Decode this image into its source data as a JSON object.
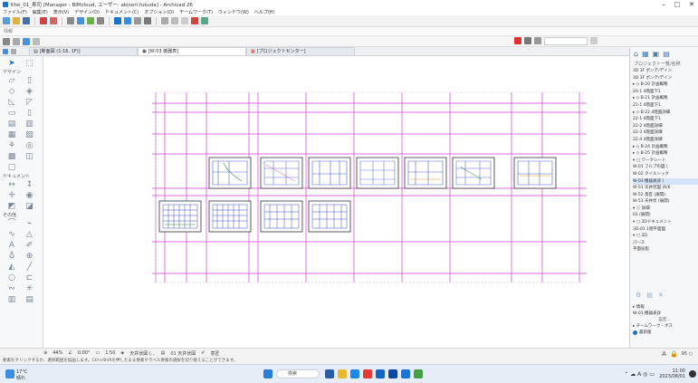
{
  "window": {
    "title": "Kho_01_寿司 [Manager - BIMcloud, ユーザー: akinori.fukuda] - Archicad 26",
    "controls": [
      "–",
      "□",
      "✕"
    ]
  },
  "menu": {
    "items": [
      "ファイル(F)",
      "編集(E)",
      "表示(V)",
      "デザイン(D)",
      "ドキュメント(C)",
      "オプション(O)",
      "チームワーク(T)",
      "ウィンドウ(W)",
      "ヘルプ(H)"
    ]
  },
  "infobox": {
    "label": "情報"
  },
  "tabs": [
    {
      "label": "[断面図 (1:16, 1F)]",
      "icon": "section-icon",
      "active": false
    },
    {
      "label": "[W-03 機器表]",
      "icon": "layout-icon",
      "active": true
    },
    {
      "label": "[プロジェクトセンター]",
      "icon": "project-icon",
      "active": false
    }
  ],
  "toolbox": {
    "sections": [
      "デザイン",
      "ドキュメント",
      "その他"
    ]
  },
  "navigator": {
    "title": "プロジェクト一覧/名称",
    "tree": [
      {
        "label": "3D 3F ポンテ/デイン",
        "selected": false
      },
      {
        "label": "3D 3F ポンテ/デイン",
        "selected": false
      },
      {
        "label": "▸ ◇ B-20 計画概略",
        "selected": false
      },
      {
        "label": "20-1 4階面下1",
        "selected": false
      },
      {
        "label": "▸ ◇ B-21 計画概略",
        "selected": false
      },
      {
        "label": "21-1 4階面下1",
        "selected": false
      },
      {
        "label": "▸ ◇ B-22 4階面詳細",
        "selected": false
      },
      {
        "label": "22-1 4階面下1",
        "selected": false
      },
      {
        "label": "22-2 4階面詳細",
        "selected": false
      },
      {
        "label": "22-3 4階面詳細",
        "selected": false
      },
      {
        "label": "22-4 4階面詳細",
        "selected": false
      },
      {
        "label": "▸ ◇ B-24 計画概略",
        "selected": false
      },
      {
        "label": "▸ ◇ B-25 計画概略",
        "selected": false
      },
      {
        "label": "▾ ▢ ワークシート",
        "selected": false
      },
      {
        "label": "W-01 フルプの図 (",
        "selected": false
      },
      {
        "label": "W-02 タイルシック",
        "selected": false
      },
      {
        "label": "W-03 機器表詳 (",
        "selected": true
      },
      {
        "label": "W-51 天井伏図 (6/6",
        "selected": false
      },
      {
        "label": "W-52 意匠 (展開)",
        "selected": false
      },
      {
        "label": "W-53 天井伏 (展開)",
        "selected": false
      },
      {
        "label": "▾ ⓘ 詳細",
        "selected": false
      },
      {
        "label": "01 (展開)",
        "selected": false
      },
      {
        "label": "▾ ▢ 3Dドキュメント",
        "selected": false
      },
      {
        "label": "3D-01 1階平面図",
        "selected": false
      },
      {
        "label": "▾ ▢ 3D",
        "selected": false
      },
      {
        "label": "パース",
        "selected": false
      },
      {
        "label": "平面投影",
        "selected": false
      }
    ],
    "props_header": "▸ 情報",
    "props_item": "W-03 機器表詳",
    "props_setting": "設定...",
    "team_header": "▸ チームワーク - ボス",
    "team_item": "最新版"
  },
  "statusbar": {
    "zoom_value": "44%",
    "angle_value": "0.00°",
    "scale_value": "1:50",
    "layer_value": "天井伏図 (...",
    "story_value": "01 天井伏図",
    "pen_value": "意匠",
    "hint": "要素をクリックするか、選択範囲を描画します。Ctrl+Shiftを押したまま要素やラベル要素の選択を切り替えることができます。",
    "ime_label": "A",
    "percent": "95 ○"
  },
  "taskbar": {
    "search_placeholder": "検索",
    "weather_temp": "17°C",
    "weather_desc": "晴れ",
    "time": "11:00",
    "date": "2023/08/01"
  },
  "colors": {
    "magenta": "#d23fd6",
    "accent": "#1a73c9"
  }
}
